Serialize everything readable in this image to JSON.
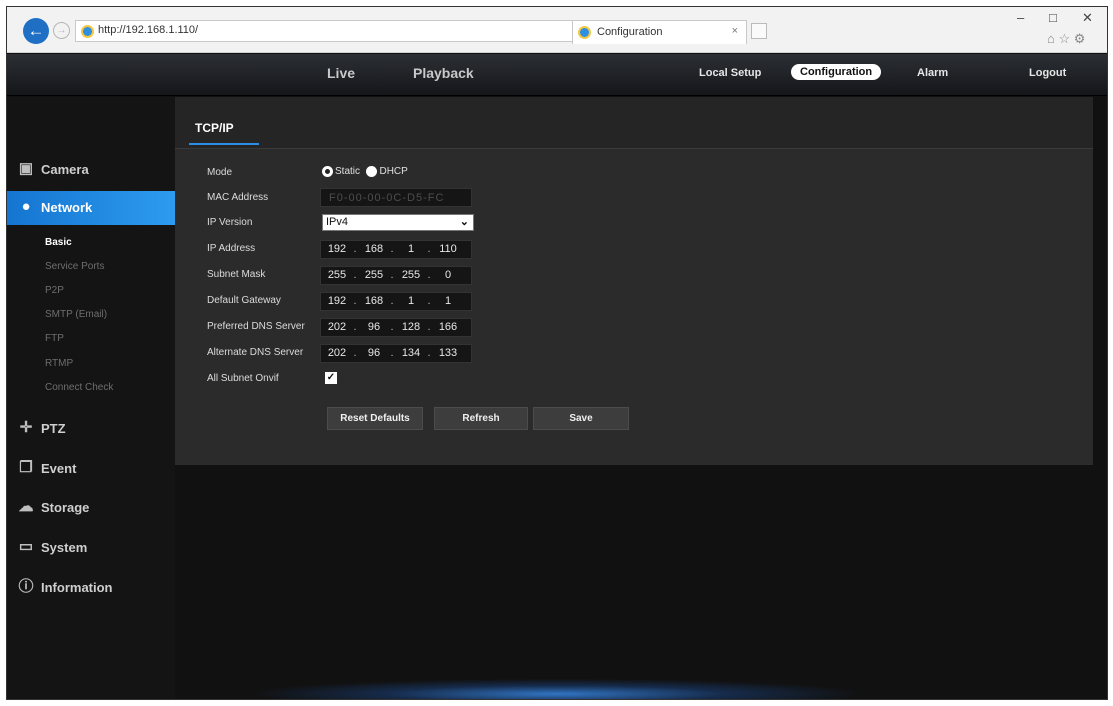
{
  "browser": {
    "url": "http://192.168.1.110/",
    "addr_tools": "⌕ • ↻",
    "tab_title": "Configuration",
    "tab_close": "×",
    "back": "←",
    "forward": "→",
    "minimize": "–",
    "maximize": "□",
    "close": "✕",
    "fav_icons": "⌂ ☆ ⚙"
  },
  "topnav": {
    "live": "Live",
    "playback": "Playback",
    "local_setup": "Local Setup",
    "configuration": "Configuration",
    "alarm": "Alarm",
    "logout": "Logout"
  },
  "sidebar": {
    "items": [
      {
        "label": "Camera",
        "icon": "camera-icon",
        "glyph": "▣"
      },
      {
        "label": "Network",
        "icon": "network-globe-icon",
        "glyph": "●"
      },
      {
        "label": "PTZ",
        "icon": "ptz-icon",
        "glyph": "✛"
      },
      {
        "label": "Event",
        "icon": "event-icon",
        "glyph": "❐"
      },
      {
        "label": "Storage",
        "icon": "storage-cloud-icon",
        "glyph": "☁"
      },
      {
        "label": "System",
        "icon": "system-monitor-icon",
        "glyph": "▭"
      },
      {
        "label": "Information",
        "icon": "info-icon",
        "glyph": "ⓘ"
      }
    ],
    "network_sub": [
      "Basic",
      "Service Ports",
      "P2P",
      "SMTP (Email)",
      "FTP",
      "RTMP",
      "Connect Check"
    ]
  },
  "panel": {
    "tab": "TCP/IP",
    "mode_label": "Mode",
    "mode_static": "Static",
    "mode_dhcp": "DHCP",
    "mac_label": "MAC Address",
    "mac_value": "F0-00-00-0C-D5-FC",
    "ipver_label": "IP Version",
    "ipver_value": "IPv4",
    "ip_label": "IP Address",
    "ip": [
      "192",
      "168",
      "1",
      "110"
    ],
    "mask_label": "Subnet Mask",
    "mask": [
      "255",
      "255",
      "255",
      "0"
    ],
    "gw_label": "Default Gateway",
    "gw": [
      "192",
      "168",
      "1",
      "1"
    ],
    "dns1_label": "Preferred DNS Server",
    "dns1": [
      "202",
      "96",
      "128",
      "166"
    ],
    "dns2_label": "Alternate DNS Server",
    "dns2": [
      "202",
      "96",
      "134",
      "133"
    ],
    "onvif_label": "All Subnet Onvif",
    "onvif_checked": true,
    "reset_label": "Reset Defaults",
    "refresh_label": "Refresh",
    "save_label": "Save"
  },
  "colors": {
    "accent": "#1f86e0",
    "panel_bg": "#2b2b2b",
    "sidebar_bg": "#141414"
  }
}
